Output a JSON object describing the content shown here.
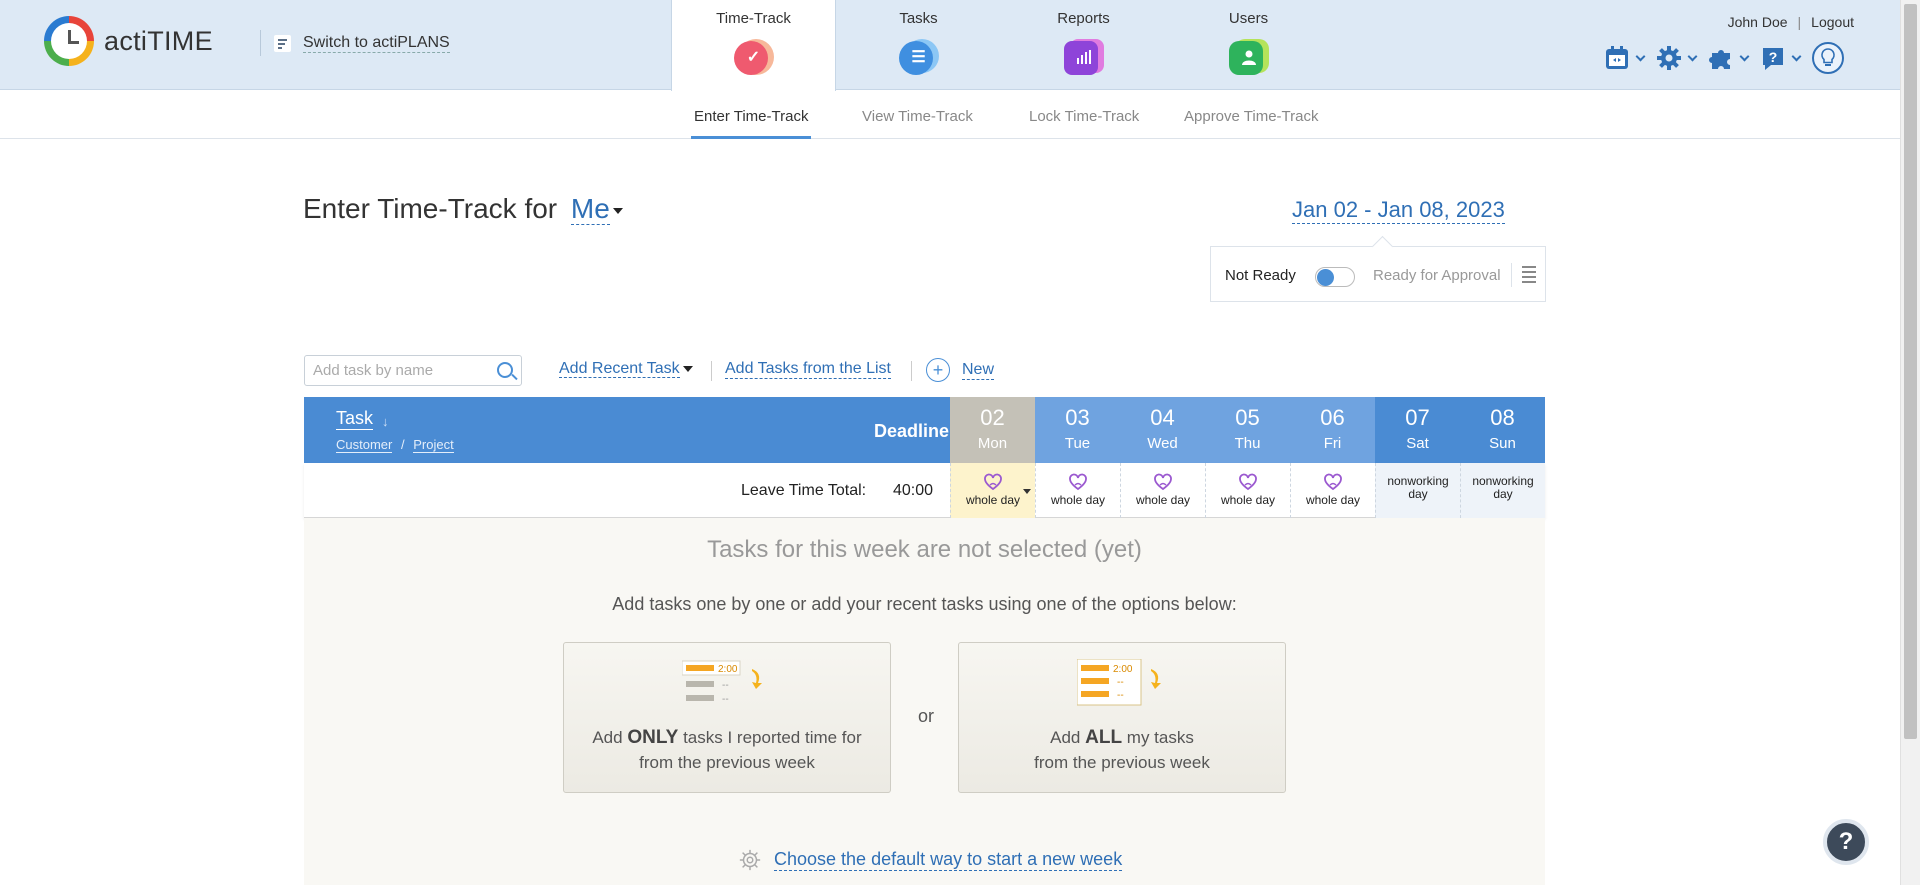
{
  "app": {
    "name": "actiTIME"
  },
  "header": {
    "switch_label": "Switch to actiPLANS",
    "nav_tabs": [
      {
        "label": "Time-Track",
        "icon": "check-icon",
        "color": "#ef5a6f"
      },
      {
        "label": "Tasks",
        "icon": "list-icon",
        "color": "#3f8fe0"
      },
      {
        "label": "Reports",
        "icon": "bar-chart-icon",
        "color": "#8e44d9"
      },
      {
        "label": "Users",
        "icon": "user-icon",
        "color": "#2eb35c"
      }
    ],
    "user_name": "John Doe",
    "logout_label": "Logout",
    "tools": [
      "calendar-icon",
      "gear-icon",
      "puzzle-icon",
      "help-icon",
      "bulb-icon"
    ]
  },
  "subnav": {
    "tabs": [
      "Enter Time-Track",
      "View Time-Track",
      "Lock Time-Track",
      "Approve Time-Track"
    ],
    "active": "Enter Time-Track"
  },
  "page": {
    "title": "Enter Time-Track for",
    "user_select": "Me",
    "date_range": "Jan 02 - Jan 08, 2023",
    "status_not_ready": "Not Ready",
    "status_ready": "Ready for Approval"
  },
  "task_bar": {
    "search_placeholder": "Add task by name",
    "add_recent": "Add Recent Task",
    "add_from_list": "Add Tasks from the List",
    "new_label": "New"
  },
  "grid": {
    "task_col": "Task",
    "customer_label": "Customer",
    "project_label": "Project",
    "separator": "/",
    "deadline_label": "Deadline",
    "days": [
      {
        "num": "02",
        "dow": "Mon",
        "kind": "today",
        "leave": "whole day"
      },
      {
        "num": "03",
        "dow": "Tue",
        "kind": "weekday",
        "leave": "whole day"
      },
      {
        "num": "04",
        "dow": "Wed",
        "kind": "weekday",
        "leave": "whole day"
      },
      {
        "num": "05",
        "dow": "Thu",
        "kind": "weekday",
        "leave": "whole day"
      },
      {
        "num": "06",
        "dow": "Fri",
        "kind": "weekday",
        "leave": "whole day"
      },
      {
        "num": "07",
        "dow": "Sat",
        "kind": "weekend",
        "leave": "nonworking day"
      },
      {
        "num": "08",
        "dow": "Sun",
        "kind": "weekend",
        "leave": "nonworking day"
      }
    ],
    "leave_label": "Leave Time Total:",
    "leave_total": "40:00"
  },
  "empty_state": {
    "title": "Tasks for this week are not selected (yet)",
    "subtitle": "Add tasks one by one or add your recent tasks using one of the options below:",
    "option1_pre": "Add ",
    "option1_bold": "ONLY",
    "option1_post": " tasks I reported time for",
    "option1_line2": "from the previous week",
    "or": "or",
    "option2_pre": "Add ",
    "option2_bold": "ALL",
    "option2_post": " my tasks",
    "option2_line2": "from the previous week",
    "illustration_time": "2:00",
    "illustration_dash": "--",
    "default_way": "Choose the default way to start a new week"
  },
  "help_button": "?",
  "colors": {
    "accent": "#2f6fb5",
    "grid_header": "#4a8bd3",
    "today": "#c4c1b7",
    "leave_icon": "#9b59d0"
  }
}
